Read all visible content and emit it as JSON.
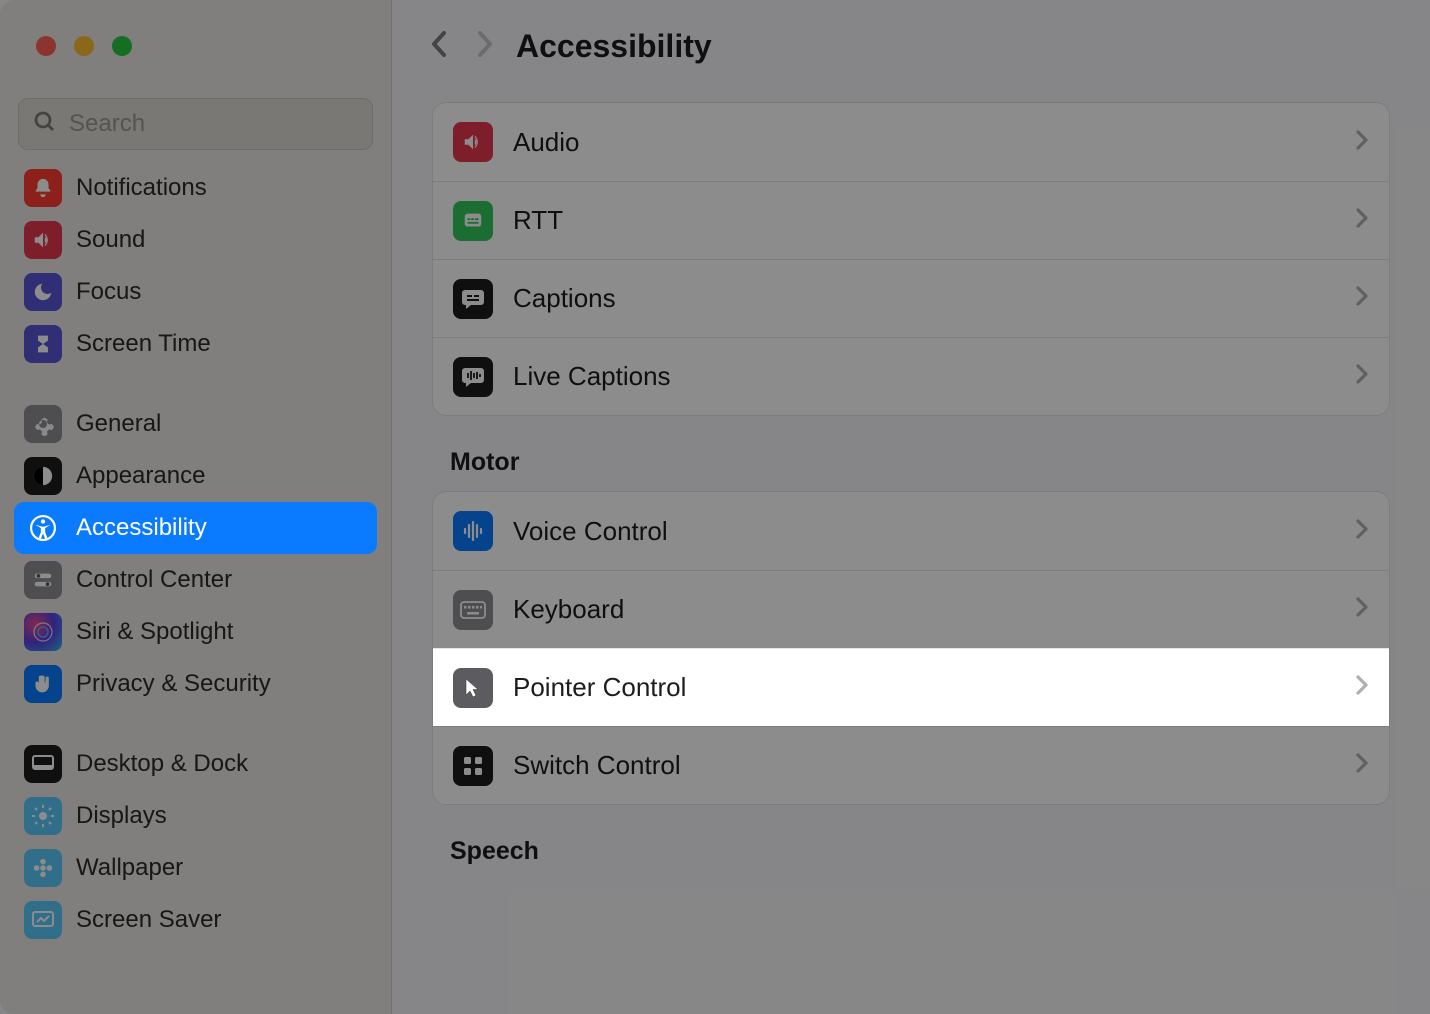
{
  "header": {
    "title": "Accessibility"
  },
  "search": {
    "placeholder": "Search"
  },
  "sidebar": {
    "items": [
      {
        "label": "Notifications",
        "icon": "bell-icon",
        "bg": "bg-red"
      },
      {
        "label": "Sound",
        "icon": "speaker-icon",
        "bg": "bg-pink"
      },
      {
        "label": "Focus",
        "icon": "moon-icon",
        "bg": "bg-purple"
      },
      {
        "label": "Screen Time",
        "icon": "hourglass-icon",
        "bg": "bg-purple"
      },
      {
        "label": "General",
        "icon": "gear-icon",
        "bg": "bg-gray"
      },
      {
        "label": "Appearance",
        "icon": "contrast-icon",
        "bg": "bg-black"
      },
      {
        "label": "Accessibility",
        "icon": "accessibility-icon",
        "bg": "bg-blue",
        "selected": true
      },
      {
        "label": "Control Center",
        "icon": "switches-icon",
        "bg": "bg-gray"
      },
      {
        "label": "Siri & Spotlight",
        "icon": "siri-icon",
        "bg": "bg-siri"
      },
      {
        "label": "Privacy & Security",
        "icon": "hand-icon",
        "bg": "bg-blue"
      },
      {
        "label": "Desktop & Dock",
        "icon": "dock-icon",
        "bg": "bg-black"
      },
      {
        "label": "Displays",
        "icon": "sun-icon",
        "bg": "bg-teal"
      },
      {
        "label": "Wallpaper",
        "icon": "flower-icon",
        "bg": "bg-teal"
      },
      {
        "label": "Screen Saver",
        "icon": "screensaver-icon",
        "bg": "bg-teal"
      }
    ]
  },
  "content": {
    "groups": [
      {
        "section": null,
        "rows": [
          {
            "label": "Audio",
            "icon": "speaker-icon",
            "bg": "bg-pink"
          },
          {
            "label": "RTT",
            "icon": "phone-text-icon",
            "bg": "bg-green"
          },
          {
            "label": "Captions",
            "icon": "caption-bubble-icon",
            "bg": "bg-black"
          },
          {
            "label": "Live Captions",
            "icon": "waveform-bubble-icon",
            "bg": "bg-black"
          }
        ]
      },
      {
        "section": "Motor",
        "rows": [
          {
            "label": "Voice Control",
            "icon": "voice-waveform-icon",
            "bg": "bg-blue"
          },
          {
            "label": "Keyboard",
            "icon": "keyboard-icon",
            "bg": "bg-gray"
          },
          {
            "label": "Pointer Control",
            "icon": "cursor-icon",
            "bg": "bg-darkgray",
            "highlight": true
          },
          {
            "label": "Switch Control",
            "icon": "grid-icon",
            "bg": "bg-black"
          }
        ]
      },
      {
        "section": "Speech",
        "rows": []
      }
    ]
  }
}
